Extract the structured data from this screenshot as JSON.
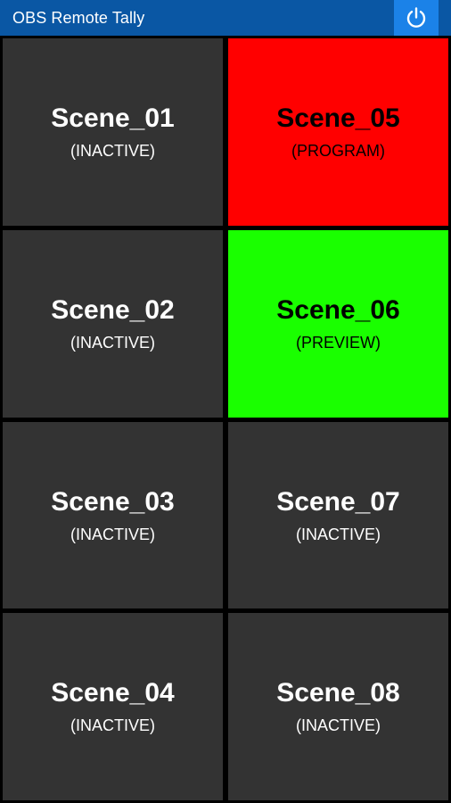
{
  "app": {
    "title": "OBS Remote Tally",
    "power_icon": "power-icon",
    "accent": "#0a57a4"
  },
  "scenes": [
    {
      "name": "Scene_01",
      "status": "(INACTIVE)"
    },
    {
      "name": "Scene_02",
      "status": "(INACTIVE)"
    },
    {
      "name": "Scene_03",
      "status": "(INACTIVE)"
    },
    {
      "name": "Scene_04",
      "status": "(INACTIVE)"
    },
    {
      "name": "Scene_05",
      "status": "(PROGRAM)"
    },
    {
      "name": "Scene_06",
      "status": "(PREVIEW)"
    },
    {
      "name": "Scene_07",
      "status": "(INACTIVE)"
    },
    {
      "name": "Scene_08",
      "status": "(INACTIVE)"
    }
  ],
  "colors": {
    "inactive": "#333333",
    "program": "#ff0000",
    "preview": "#1aff00"
  }
}
